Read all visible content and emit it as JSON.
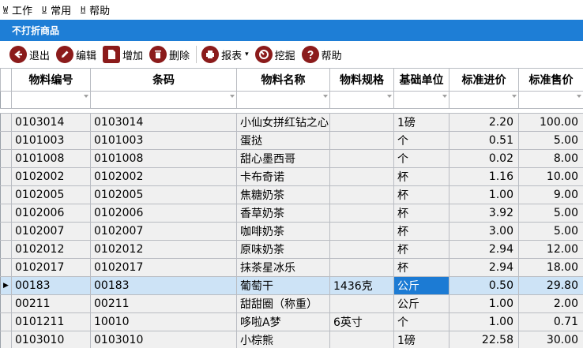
{
  "menubar": {
    "items": [
      {
        "key": "W",
        "label": "工作"
      },
      {
        "key": "U",
        "label": "常用"
      },
      {
        "key": "H",
        "label": "帮助"
      }
    ]
  },
  "window": {
    "title": "不打折商品"
  },
  "toolbar": {
    "exit_label": "退出",
    "edit_label": "编辑",
    "add_label": "增加",
    "delete_label": "删除",
    "report_label": "报表",
    "report_arrow": "▾",
    "mine_label": "挖掘",
    "help_label": "帮助"
  },
  "table": {
    "columns": [
      "物料编号",
      "条码",
      "物料名称",
      "物料规格",
      "基础单位",
      "标准进价",
      "标准售价"
    ],
    "rows": [
      [
        "0103014",
        "0103014",
        "小仙女拼红钻之心",
        "",
        "1磅",
        "2.20",
        "100.00"
      ],
      [
        "0101003",
        "0101003",
        "蛋挞",
        "",
        "个",
        "0.51",
        "5.00"
      ],
      [
        "0101008",
        "0101008",
        "甜心墨西哥",
        "",
        "个",
        "0.02",
        "8.00"
      ],
      [
        "0102002",
        "0102002",
        "卡布奇诺",
        "",
        "杯",
        "1.16",
        "10.00"
      ],
      [
        "0102005",
        "0102005",
        "焦糖奶茶",
        "",
        "杯",
        "1.00",
        "9.00"
      ],
      [
        "0102006",
        "0102006",
        "香草奶茶",
        "",
        "杯",
        "3.92",
        "5.00"
      ],
      [
        "0102007",
        "0102007",
        "咖啡奶茶",
        "",
        "杯",
        "3.00",
        "5.00"
      ],
      [
        "0102012",
        "0102012",
        "原味奶茶",
        "",
        "杯",
        "2.94",
        "12.00"
      ],
      [
        "0102017",
        "0102017",
        "抹茶星冰乐",
        "",
        "杯",
        "2.94",
        "18.00"
      ],
      [
        "00183",
        "00183",
        "葡萄干",
        "1436克",
        "公斤",
        "0.50",
        "29.80"
      ],
      [
        "00211",
        "00211",
        "甜甜圈（称重）",
        "",
        "公斤",
        "1.00",
        "2.00"
      ],
      [
        "0101211",
        "10010",
        "哆啦A梦",
        "6英寸",
        "个",
        "1.00",
        "0.71"
      ],
      [
        "0103010",
        "0103010",
        "小棕熊",
        "",
        "1磅",
        "22.58",
        "30.00"
      ]
    ],
    "row_pointer": "▶"
  }
}
